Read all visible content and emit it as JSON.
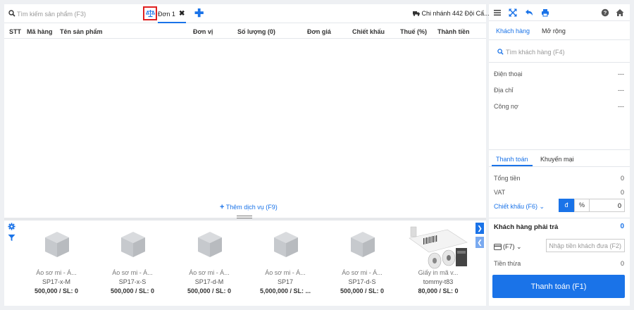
{
  "header": {
    "search_placeholder": "Tìm kiếm sản phẩm (F3)",
    "tab_label": "Đơn 1",
    "tab_close": "✖",
    "add_tab": "✚",
    "branch": "Chi nhánh 442 Đội Cấ..."
  },
  "table": {
    "columns": [
      "STT",
      "Mã hàng",
      "Tên sản phẩm",
      "Đơn vị",
      "Số lượng (0)",
      "Đơn giá",
      "Chiết khấu",
      "Thuế (%)",
      "Thành tiền"
    ]
  },
  "add_service": "Thêm dịch vụ (F9)",
  "products": [
    {
      "name": "Áo sơ mi - Á...",
      "code": "SP17-x-M",
      "price": "500,000 / SL: 0"
    },
    {
      "name": "Áo sơ mi - Á...",
      "code": "SP17-x-S",
      "price": "500,000 / SL: 0"
    },
    {
      "name": "Áo sơ mi - Á...",
      "code": "SP17-d-M",
      "price": "500,000 / SL: 0"
    },
    {
      "name": "Áo sơ mi - Á...",
      "code": "SP17",
      "price": "5,000,000 / SL: ..."
    },
    {
      "name": "Áo sơ mi - Á...",
      "code": "SP17-d-S",
      "price": "500,000 / SL: 0"
    },
    {
      "name": "Giấy in mã v...",
      "code": "tommy-t83",
      "price": "80,000 / SL: 0"
    }
  ],
  "right": {
    "top_tabs": [
      "Khách hàng",
      "Mở rộng"
    ],
    "customer_search_placeholder": "Tìm khách hàng (F4)",
    "phone_label": "Điện thoại",
    "phone_value": "---",
    "address_label": "Địa chỉ",
    "address_value": "---",
    "debt_label": "Công nợ",
    "debt_value": "---",
    "bottom_tabs": [
      "Thanh toán",
      "Khuyến mại"
    ],
    "total_label": "Tổng tiền",
    "total_value": "0",
    "vat_label": "VAT",
    "vat_value": "0",
    "discount_label": "Chiết khấu (F6) ⌄",
    "unit_currency": "đ",
    "unit_percent": "%",
    "discount_value": "0",
    "pay_due_label": "Khách hàng phải trả",
    "pay_due_value": "0",
    "payment_method": "(F7) ⌄",
    "cash_placeholder": "Nhập tiền khách đưa (F2)",
    "change_label": "Tiền thừa",
    "change_value": "0",
    "pay_button": "Thanh toán (F1)"
  },
  "colors": {
    "accent": "#1a73e8",
    "highlight_border": "#e02020"
  }
}
